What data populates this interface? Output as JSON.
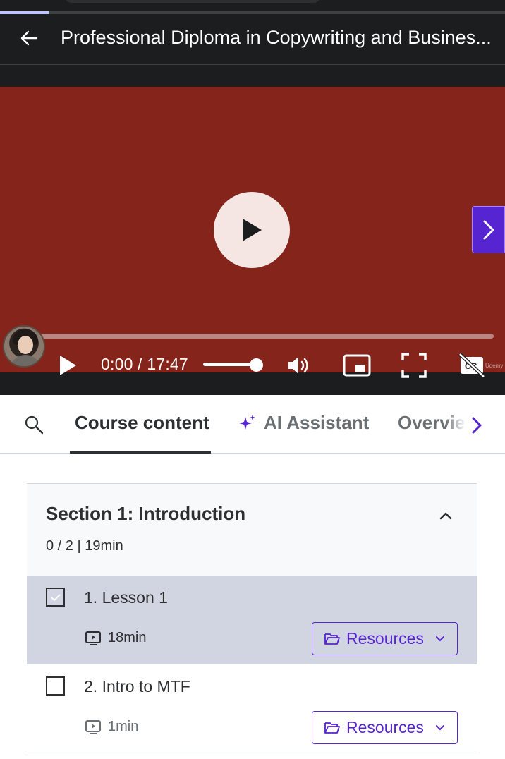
{
  "topbar": {
    "progress_fraction": 0.096
  },
  "header": {
    "back_icon": "arrow-left-icon",
    "title": "Professional Diploma in Copywriting and Busines..."
  },
  "player": {
    "background_color": "#84241b",
    "time_display": "0:00 / 17:47",
    "volume_fraction": 1.0,
    "watermark": "Ūdemy",
    "icons": [
      "play-icon",
      "volume-icon",
      "picture-in-picture-icon",
      "fullscreen-icon",
      "captions-off-icon",
      "chevron-right-icon"
    ]
  },
  "tabs": {
    "items": [
      {
        "label": "Course content",
        "active": true
      },
      {
        "label": "AI Assistant",
        "active": false
      },
      {
        "label": "Overvie",
        "active": false
      }
    ]
  },
  "section": {
    "title": "Section 1: Introduction",
    "meta": "0 / 2 | 19min",
    "lessons": [
      {
        "title": "1. Lesson 1",
        "duration": "18min",
        "resources_label": "Resources",
        "active": true,
        "checked": true
      },
      {
        "title": "2. Intro to MTF",
        "duration": "1min",
        "resources_label": "Resources",
        "active": false,
        "checked": false
      }
    ]
  },
  "colors": {
    "accent": "#5624d0",
    "dark": "#1c1d1f",
    "active_row": "#d1d5e2",
    "section_bg": "#f7f9fa"
  }
}
